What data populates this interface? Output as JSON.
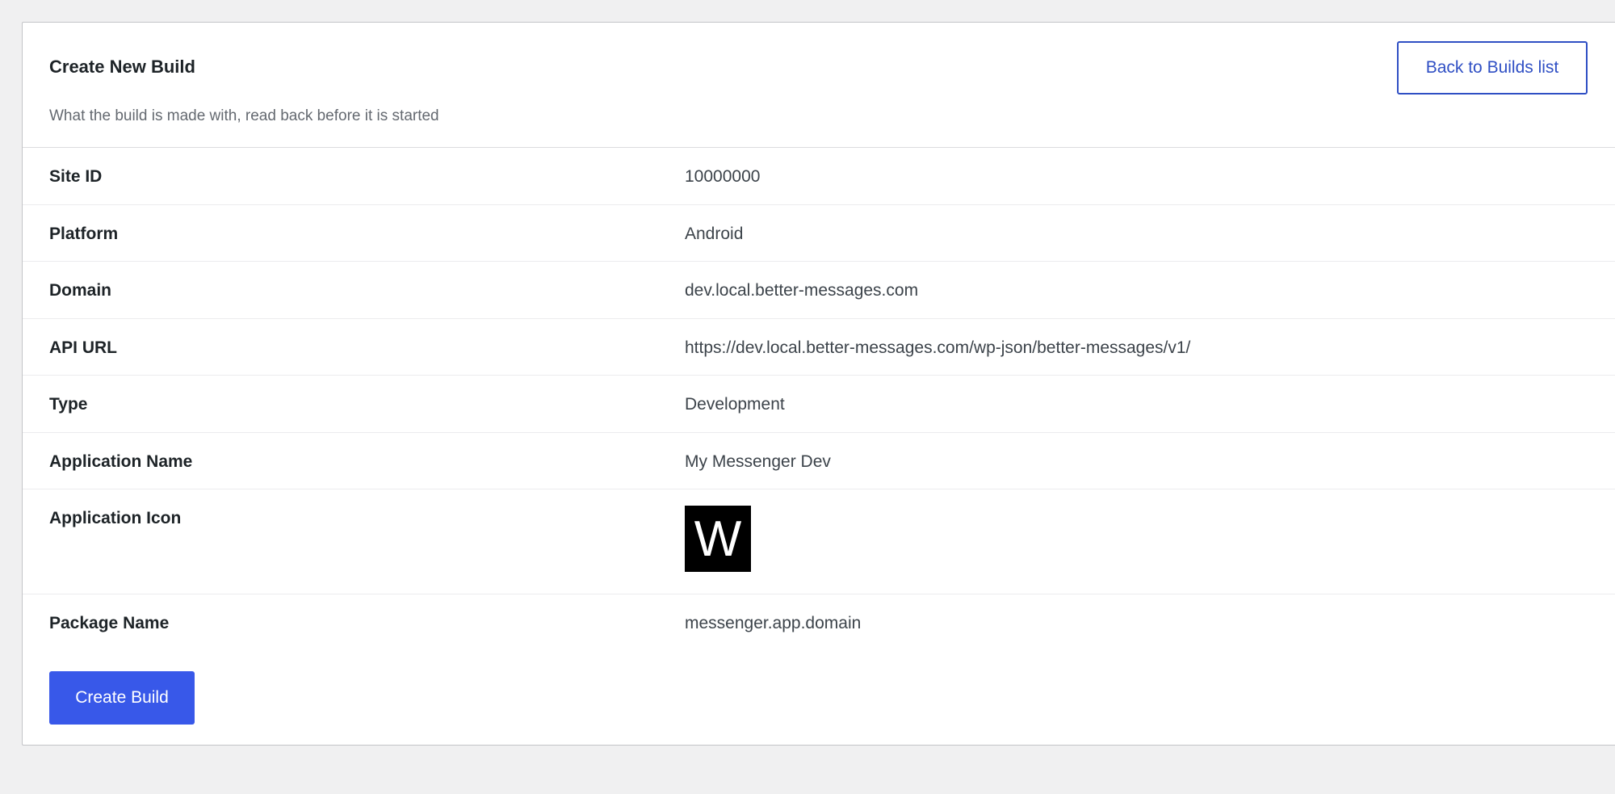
{
  "header": {
    "title": "Create New Build",
    "subtitle": "What the build is made with, read back before it is started",
    "back_button_label": "Back to Builds list"
  },
  "details": [
    {
      "label": "Site ID",
      "value": "10000000"
    },
    {
      "label": "Platform",
      "value": "Android"
    },
    {
      "label": "Domain",
      "value": "dev.local.better-messages.com"
    },
    {
      "label": "API URL",
      "value": "https://dev.local.better-messages.com/wp-json/better-messages/v1/"
    },
    {
      "label": "Type",
      "value": "Development"
    },
    {
      "label": "Application Name",
      "value": "My Messenger Dev"
    },
    {
      "label": "Application Icon",
      "icon_letter": "W"
    },
    {
      "label": "Package Name",
      "value": "messenger.app.domain"
    }
  ],
  "actions": {
    "create_button_label": "Create Build"
  },
  "colors": {
    "accent": "#3858e9",
    "link": "#2f4fc4",
    "icon_background": "#000000"
  }
}
